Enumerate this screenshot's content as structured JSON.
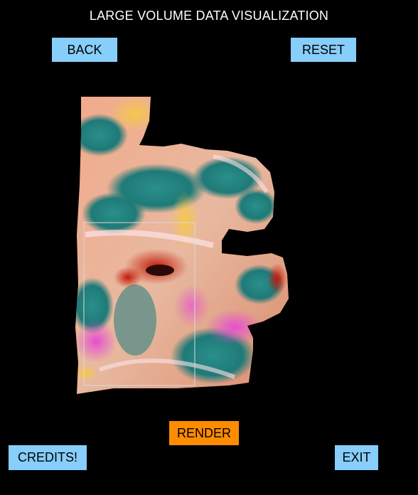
{
  "title": "LARGE VOLUME DATA VISUALIZATION",
  "buttons": {
    "back": "BACK",
    "reset": "RESET",
    "render": "RENDER",
    "credits": "CREDITS!",
    "exit": "EXIT"
  },
  "colors": {
    "background": "#000000",
    "button": "#87cefa",
    "render_button": "#ff8c00",
    "title_text": "#ffffff",
    "selection_box": "#d9d9d9"
  },
  "icons": {
    "volume": "volume-render-image"
  }
}
